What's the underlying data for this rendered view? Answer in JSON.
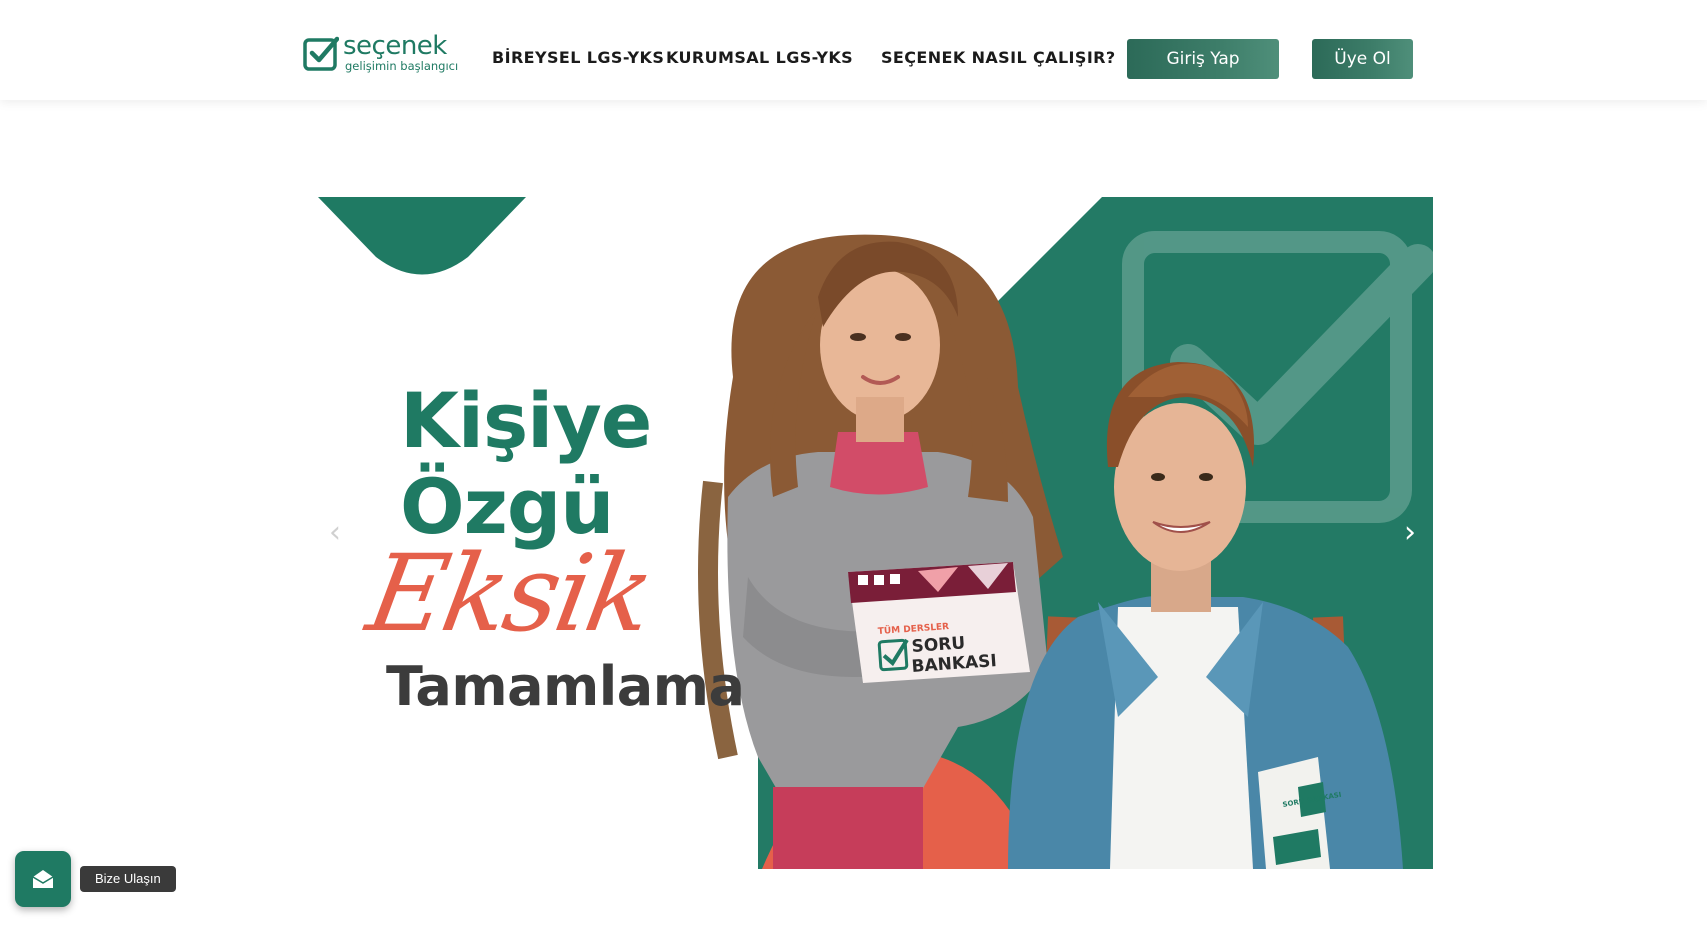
{
  "logo": {
    "wordmark": "seçenek",
    "tagline": "gelişimin başlangıcı",
    "brand_color": "#1f7a63"
  },
  "nav": {
    "items": [
      {
        "label": "BİREYSEL LGS-YKS"
      },
      {
        "label": "KURUMSAL LGS-YKS"
      },
      {
        "label": "SEÇENEK NASIL ÇALIŞIR?"
      }
    ]
  },
  "auth": {
    "login_label": "Giriş Yap",
    "signup_label": "Üye Ol"
  },
  "hero": {
    "line1": "Kişiye",
    "line2": "Özgü",
    "line3": "Eksik",
    "line4": "Tamamlama",
    "book": {
      "small": "TÜM DERSLER",
      "line1": "SORU",
      "line2": "BANKASI",
      "spine": "SORU BANKASI"
    },
    "prev_icon": "chevron-left",
    "next_icon": "chevron-right",
    "colors": {
      "green": "#1f7a63",
      "coral": "#e5604a",
      "dark_text": "#3c3c3c"
    }
  },
  "contact": {
    "label": "Bize Ulaşın",
    "icon": "envelope-open-icon"
  }
}
